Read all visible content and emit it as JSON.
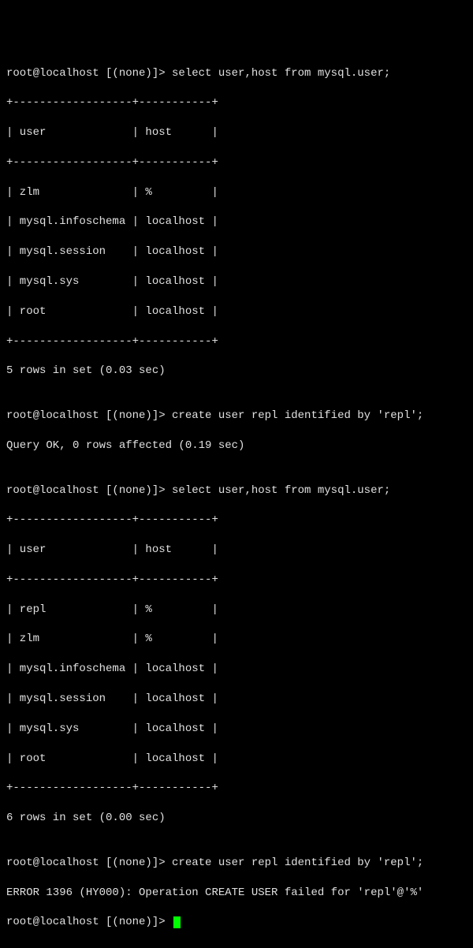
{
  "line1": "root@localhost [(none)]> select user,host from mysql.user;",
  "sep": "+------------------+-----------+",
  "header": "| user             | host      |",
  "t1r1": "| zlm              | %         |",
  "t1r2": "| mysql.infoschema | localhost |",
  "t1r3": "| mysql.session    | localhost |",
  "t1r4": "| mysql.sys        | localhost |",
  "t1r5": "| root             | localhost |",
  "t1footer": "5 rows in set (0.03 sec)",
  "blank": "",
  "line_create": "root@localhost [(none)]> create user repl identified by 'repl';",
  "create_result": "Query OK, 0 rows affected (0.19 sec)",
  "line_select2": "root@localhost [(none)]> select user,host from mysql.user;",
  "t2r1": "| repl             | %         |",
  "t2r2": "| zlm              | %         |",
  "t2r3": "| mysql.infoschema | localhost |",
  "t2r4": "| mysql.session    | localhost |",
  "t2r5": "| mysql.sys        | localhost |",
  "t2r6": "| root             | localhost |",
  "t2footer": "6 rows in set (0.00 sec)",
  "line_create2": "root@localhost [(none)]> create user repl identified by 'repl';",
  "error": "ERROR 1396 (HY000): Operation CREATE USER failed for 'repl'@'%'",
  "final_prompt": "root@localhost [(none)]> "
}
